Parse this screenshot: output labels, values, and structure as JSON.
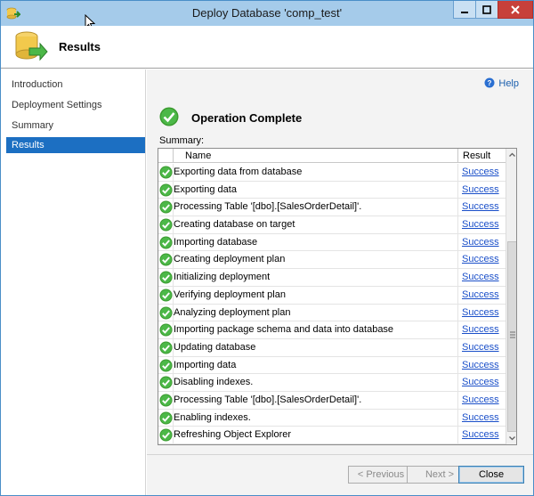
{
  "window": {
    "title": "Deploy Database 'comp_test'"
  },
  "header": {
    "title": "Results",
    "icon": "database-deploy-icon"
  },
  "sidebar": {
    "items": [
      {
        "label": "Introduction",
        "active": false
      },
      {
        "label": "Deployment Settings",
        "active": false
      },
      {
        "label": "Summary",
        "active": false
      },
      {
        "label": "Results",
        "active": true
      }
    ]
  },
  "main": {
    "help_label": "Help",
    "operation_title": "Operation Complete",
    "summary_label": "Summary:",
    "columns": {
      "name": "Name",
      "result": "Result"
    },
    "rows": [
      {
        "name": "Exporting data from database",
        "result": "Success"
      },
      {
        "name": "Exporting data",
        "result": "Success"
      },
      {
        "name": "Processing Table '[dbo].[SalesOrderDetail]'.",
        "result": "Success"
      },
      {
        "name": "Creating database on target",
        "result": "Success"
      },
      {
        "name": "Importing database",
        "result": "Success"
      },
      {
        "name": "Creating deployment plan",
        "result": "Success"
      },
      {
        "name": "Initializing deployment",
        "result": "Success"
      },
      {
        "name": "Verifying deployment plan",
        "result": "Success"
      },
      {
        "name": "Analyzing deployment plan",
        "result": "Success"
      },
      {
        "name": "Importing package schema and data into database",
        "result": "Success"
      },
      {
        "name": "Updating database",
        "result": "Success"
      },
      {
        "name": "Importing data",
        "result": "Success"
      },
      {
        "name": "Disabling indexes.",
        "result": "Success"
      },
      {
        "name": "Processing Table '[dbo].[SalesOrderDetail]'.",
        "result": "Success"
      },
      {
        "name": "Enabling indexes.",
        "result": "Success"
      },
      {
        "name": "Refreshing Object Explorer",
        "result": "Success"
      }
    ]
  },
  "footer": {
    "previous_label": "< Previous",
    "next_label": "Next >",
    "close_label": "Close"
  },
  "colors": {
    "accent": "#1c6fc2",
    "success": "#3a9a2e",
    "link": "#1a4fc9",
    "close_button": "#c7403a"
  }
}
